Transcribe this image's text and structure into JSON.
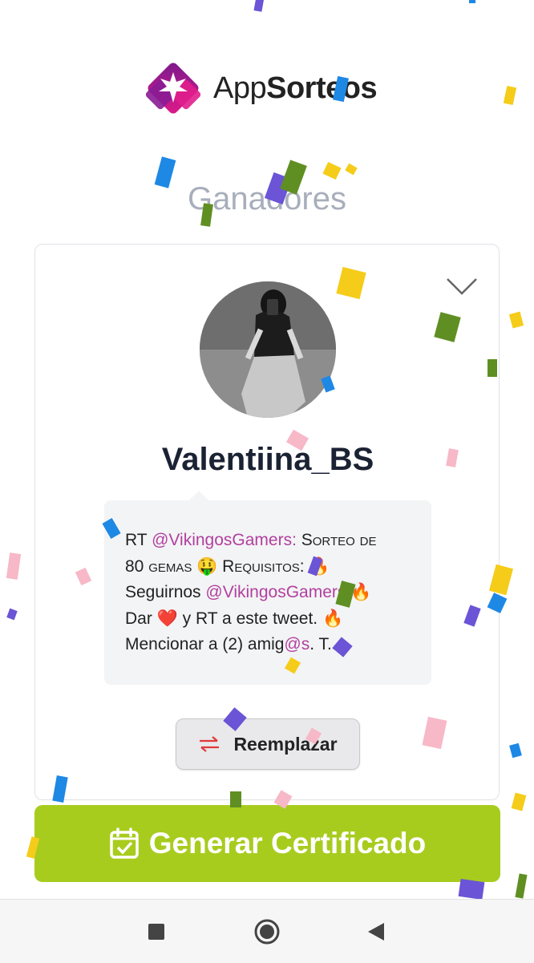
{
  "brand": {
    "name_regular": "App",
    "name_bold": "Sorteos"
  },
  "section_title": "Ganadores",
  "winner": {
    "username": "Valentiina_BS",
    "tweet": {
      "line1_a": "RT ",
      "line1_mention": "@VikingosGamers:",
      "line1_b": " Sorteo de",
      "line2": "80 gemas 🤑 Requisitos: 🔥",
      "line3_a": "Seguirnos ",
      "line3_mention": "@VikingosGamers",
      "line3_b": " 🔥",
      "line4": "Dar ❤️ y RT a este tweet. 🔥",
      "line5_a": "Mencionar a (2) amig",
      "line5_mention": "@s",
      "line5_b": ". T..."
    }
  },
  "buttons": {
    "replace_label": "Reemplazar",
    "certificate_label": "Generar Certificado"
  },
  "colors": {
    "accent_green": "#a8cc1e",
    "mention_purple": "#b23fa0",
    "brand_magenta": "#b0169c",
    "title_grey": "#a8aebb"
  },
  "icons": {
    "collapse": "chevron-down-icon",
    "replace": "swap-arrows-icon",
    "certificate": "calendar-check-icon",
    "nav_recents": "square-icon",
    "nav_home": "circle-icon",
    "nav_back": "triangle-back-icon"
  }
}
